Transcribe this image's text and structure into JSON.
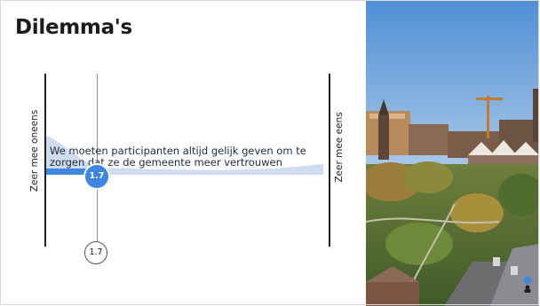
{
  "slide": {
    "title": "Dilemma's",
    "left_label": "Zeer mee oneens",
    "right_label": "Zeer mee eens",
    "statement": "We moeten participanten altijd gelijk geven om te zorgen dat ze de gemeente meer vertrouwen",
    "score": "1.7",
    "average": "1.7"
  },
  "colors": {
    "accent": "#3e86e0",
    "distribution": "#cfdcf0",
    "axis": "#222222"
  },
  "photo": {
    "icon": "city-aerial-photo"
  },
  "overlay": {
    "icon": "participant-icon"
  }
}
